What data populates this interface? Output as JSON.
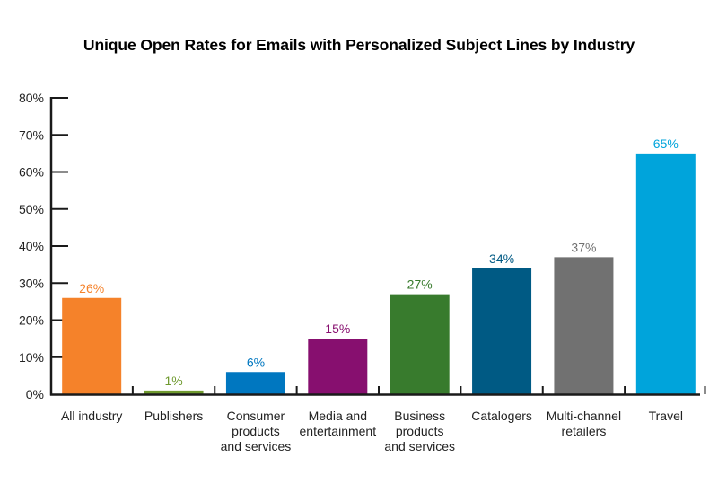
{
  "chart_data": {
    "type": "bar",
    "title": "Unique Open Rates for Emails with Personalized Subject Lines by Industry",
    "xlabel": "",
    "ylabel": "",
    "ylim": [
      0,
      80
    ],
    "y_ticks": [
      0,
      10,
      20,
      30,
      40,
      50,
      60,
      70,
      80
    ],
    "y_tick_labels": [
      "0%",
      "10%",
      "20%",
      "30%",
      "40%",
      "50%",
      "60%",
      "70%",
      "80%"
    ],
    "grid": false,
    "legend": "none",
    "categories": [
      "All industry",
      "Publishers",
      "Consumer products and services",
      "Media and entertainment",
      "Business products and services",
      "Catalogers",
      "Multi-channel retailers",
      "Travel"
    ],
    "category_label_lines": [
      [
        "All industry"
      ],
      [
        "Publishers"
      ],
      [
        "Consumer",
        "products",
        "and services"
      ],
      [
        "Media and",
        "entertainment"
      ],
      [
        "Business",
        "products",
        "and services"
      ],
      [
        "Catalogers"
      ],
      [
        "Multi-channel",
        "retailers"
      ],
      [
        "Travel"
      ]
    ],
    "values": [
      26,
      1,
      6,
      15,
      27,
      34,
      37,
      65
    ],
    "data_labels": [
      "26%",
      "1%",
      "6%",
      "15%",
      "27%",
      "34%",
      "37%",
      "65%"
    ],
    "colors": [
      "#f5822a",
      "#6f9a2f",
      "#0077c0",
      "#870f6f",
      "#387b2d",
      "#005a84",
      "#717171",
      "#00a4db"
    ],
    "label_colors": [
      "#f5822a",
      "#6f9a2f",
      "#0077c0",
      "#870f6f",
      "#387b2d",
      "#005a84",
      "#717171",
      "#00a4db"
    ],
    "axis_color": "#1a1a1a"
  }
}
